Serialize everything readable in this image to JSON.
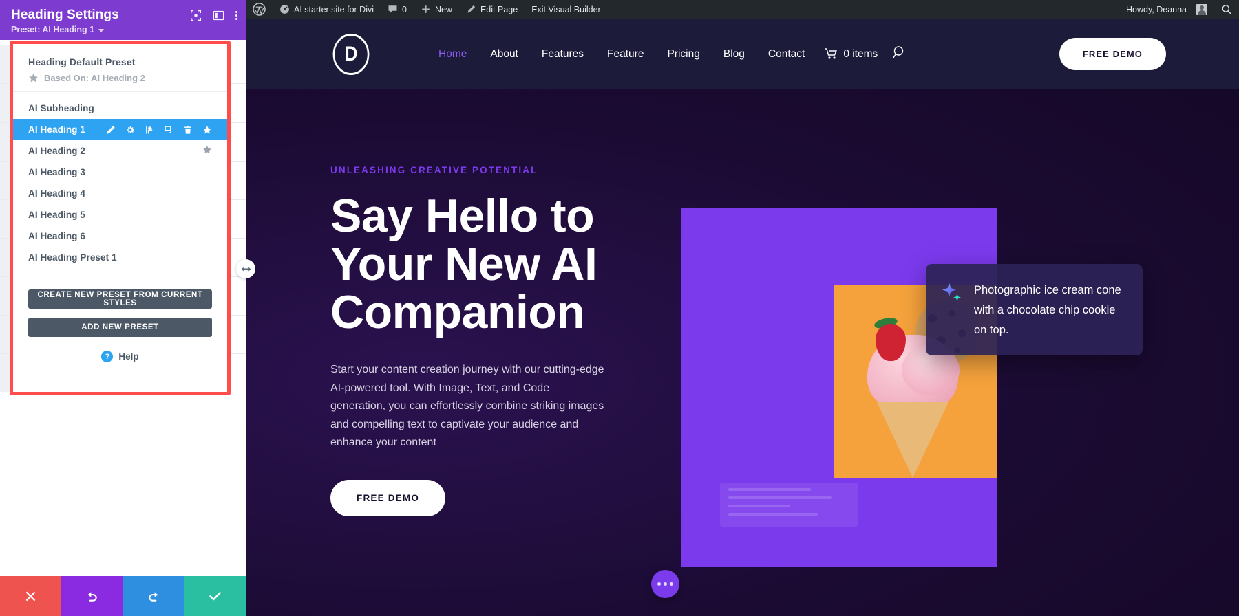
{
  "builder": {
    "header": {
      "title": "Heading Settings",
      "preset_label": "Preset: AI Heading 1",
      "icons": [
        "focus-target-icon",
        "panel-layout-icon",
        "more-vertical-icon"
      ]
    },
    "preset_popover": {
      "default_title": "Heading Default Preset",
      "based_on_label": "Based On: AI Heading 2",
      "items": [
        {
          "label": "AI Subheading",
          "selected": false,
          "starred": false
        },
        {
          "label": "AI Heading 1",
          "selected": true,
          "starred": true
        },
        {
          "label": "AI Heading 2",
          "selected": false,
          "starred": true
        },
        {
          "label": "AI Heading 3",
          "selected": false,
          "starred": false
        },
        {
          "label": "AI Heading 4",
          "selected": false,
          "starred": false
        },
        {
          "label": "AI Heading 5",
          "selected": false,
          "starred": false
        },
        {
          "label": "AI Heading 6",
          "selected": false,
          "starred": false
        },
        {
          "label": "AI Heading Preset 1",
          "selected": false,
          "starred": false
        }
      ],
      "row_actions": [
        "edit-pencil-icon",
        "settings-gear-icon",
        "export-icon",
        "duplicate-icon",
        "trash-icon",
        "star-icon"
      ],
      "create_button": "Create New Preset From Current Styles",
      "add_button": "Add New Preset",
      "help_label": "Help",
      "highlight_color": "#ff4d4d"
    },
    "action_bar": [
      {
        "name": "discard-button",
        "icon": "close-icon",
        "color": "#ef5350"
      },
      {
        "name": "undo-button",
        "icon": "undo-icon",
        "color": "#8a2be2"
      },
      {
        "name": "redo-button",
        "icon": "redo-icon",
        "color": "#2e8fe0"
      },
      {
        "name": "save-button",
        "icon": "check-icon",
        "color": "#2bbfa2"
      }
    ],
    "resize_handle": "horizontal-resize-icon"
  },
  "wp_adminbar": {
    "logo": "wordpress-logo-icon",
    "site_name": "AI starter site for Divi",
    "comments_count": "0",
    "new_label": "New",
    "edit_page_label": "Edit Page",
    "exit_builder_label": "Exit Visual Builder",
    "howdy": "Howdy, Deanna",
    "search": "search-icon",
    "bg_color": "#23282d"
  },
  "site": {
    "logo_letter": "D",
    "nav": [
      {
        "label": "Home",
        "active": true
      },
      {
        "label": "About",
        "active": false
      },
      {
        "label": "Features",
        "active": false
      },
      {
        "label": "Feature",
        "active": false
      },
      {
        "label": "Pricing",
        "active": false
      },
      {
        "label": "Blog",
        "active": false
      },
      {
        "label": "Contact",
        "active": false
      }
    ],
    "cart_label": "0 items",
    "nav_cta": "FREE DEMO",
    "hero": {
      "eyebrow": "UNLEASHING CREATIVE POTENTIAL",
      "heading_line1": "Say Hello to",
      "heading_line2": "Your New AI",
      "heading_line3": "Companion",
      "paragraph": "Start your content creation journey with our cutting-edge AI-powered tool. With Image, Text, and Code generation, you can effortlessly combine striking images and compelling text to captivate your audience and enhance your content",
      "cta": "FREE DEMO",
      "ai_caption": "Photographic ice cream cone with a chocolate chip cookie on top.",
      "accent_color": "#7c3aed",
      "eyebrow_color": "#7c3aed"
    },
    "floating_menu": "more-options-icon"
  }
}
